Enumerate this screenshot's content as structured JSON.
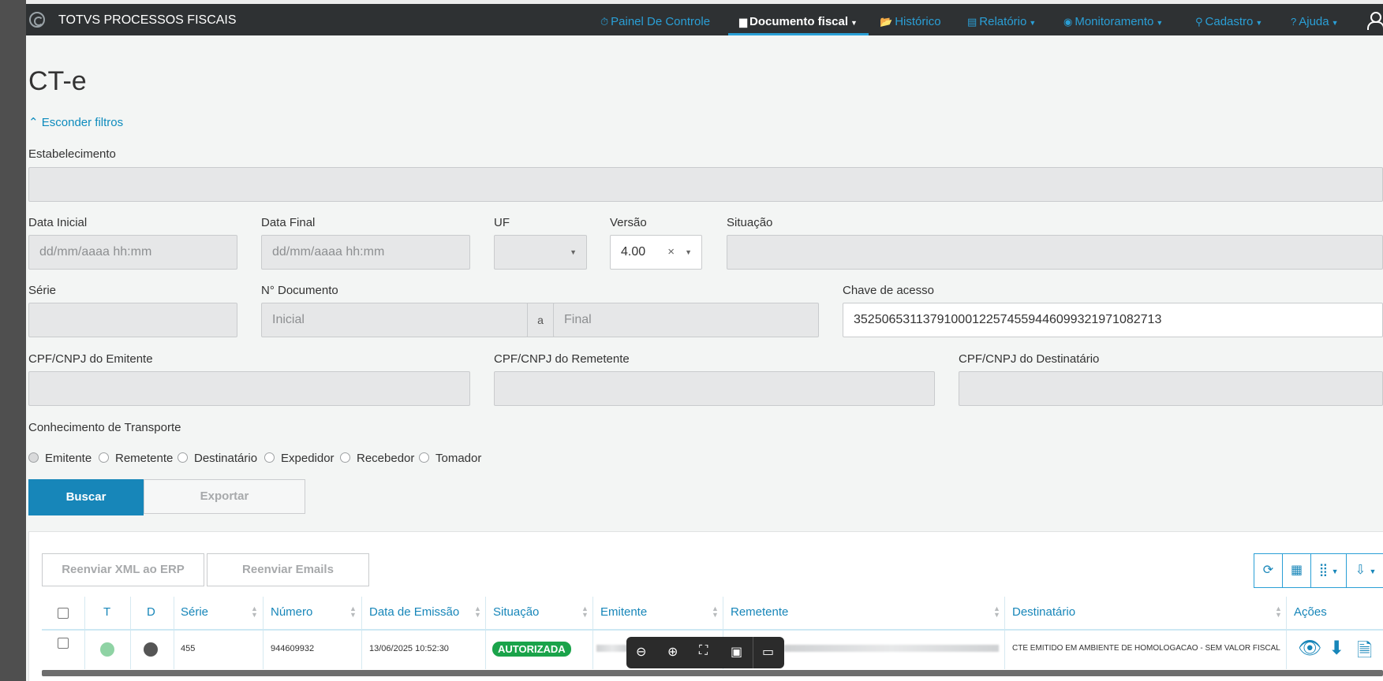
{
  "navbar": {
    "brand": "TOTVS PROCESSOS FISCAIS",
    "items": [
      {
        "icon": "⏱",
        "label": "Painel De Controle",
        "caret": ""
      },
      {
        "icon": "▆",
        "label": "Documento fiscal",
        "caret": "▼"
      },
      {
        "icon": "📂",
        "label": "Histórico",
        "caret": ""
      },
      {
        "icon": "▤",
        "label": "Relatório",
        "caret": "▼"
      },
      {
        "icon": "◉",
        "label": "Monitoramento",
        "caret": "▼"
      },
      {
        "icon": "⚲",
        "label": "Cadastro",
        "caret": "▼"
      },
      {
        "icon": "?",
        "label": "Ajuda",
        "caret": "▼"
      }
    ]
  },
  "page": {
    "title": "CT-e",
    "filters_toggle": "Esconder filtros"
  },
  "filters": {
    "estabelecimento": {
      "label": "Estabelecimento",
      "value": ""
    },
    "data_inicial": {
      "label": "Data Inicial",
      "placeholder": "dd/mm/aaaa hh:mm"
    },
    "data_final": {
      "label": "Data Final",
      "placeholder": "dd/mm/aaaa hh:mm"
    },
    "uf": {
      "label": "UF",
      "value": ""
    },
    "versao": {
      "label": "Versão",
      "value": "4.00"
    },
    "situacao": {
      "label": "Situação",
      "value": ""
    },
    "serie": {
      "label": "Série",
      "value": ""
    },
    "n_documento": {
      "label": "N° Documento",
      "placeholder_from": "Inicial",
      "separator": "a",
      "placeholder_to": "Final"
    },
    "chave_acesso": {
      "label": "Chave de acesso",
      "value": "35250653113791000122574559446099321971082713"
    },
    "cpf_emitente": {
      "label": "CPF/CNPJ do Emitente",
      "value": ""
    },
    "cpf_remetente": {
      "label": "CPF/CNPJ do Remetente",
      "value": ""
    },
    "cpf_destinatario": {
      "label": "CPF/CNPJ do Destinatário",
      "value": ""
    },
    "conhecimento": {
      "label": "Conhecimento de Transporte",
      "options": [
        "Emitente",
        "Remetente",
        "Destinatário",
        "Expedidor",
        "Recebedor",
        "Tomador"
      ],
      "selected": "Emitente"
    },
    "buscar_label": "Buscar",
    "exportar_label": "Exportar"
  },
  "grid": {
    "reenviar_xml_label": "Reenviar XML ao ERP",
    "reenviar_emails_label": "Reenviar Emails",
    "columns": [
      "T",
      "D",
      "Série",
      "Número",
      "Data de Emissão",
      "Situação",
      "Emitente",
      "Remetente",
      "Destinatário",
      "Ações"
    ],
    "rows": [
      {
        "t_color": "#8fd3a4",
        "d_color": "#555555",
        "serie": "455",
        "numero": "944609932",
        "data_emissao": "13/06/2025 10:52:30",
        "situacao": "AUTORIZADA",
        "destinatario": "CTE EMITIDO EM AMBIENTE DE HOMOLOGACAO - SEM VALOR FISCAL"
      }
    ]
  }
}
